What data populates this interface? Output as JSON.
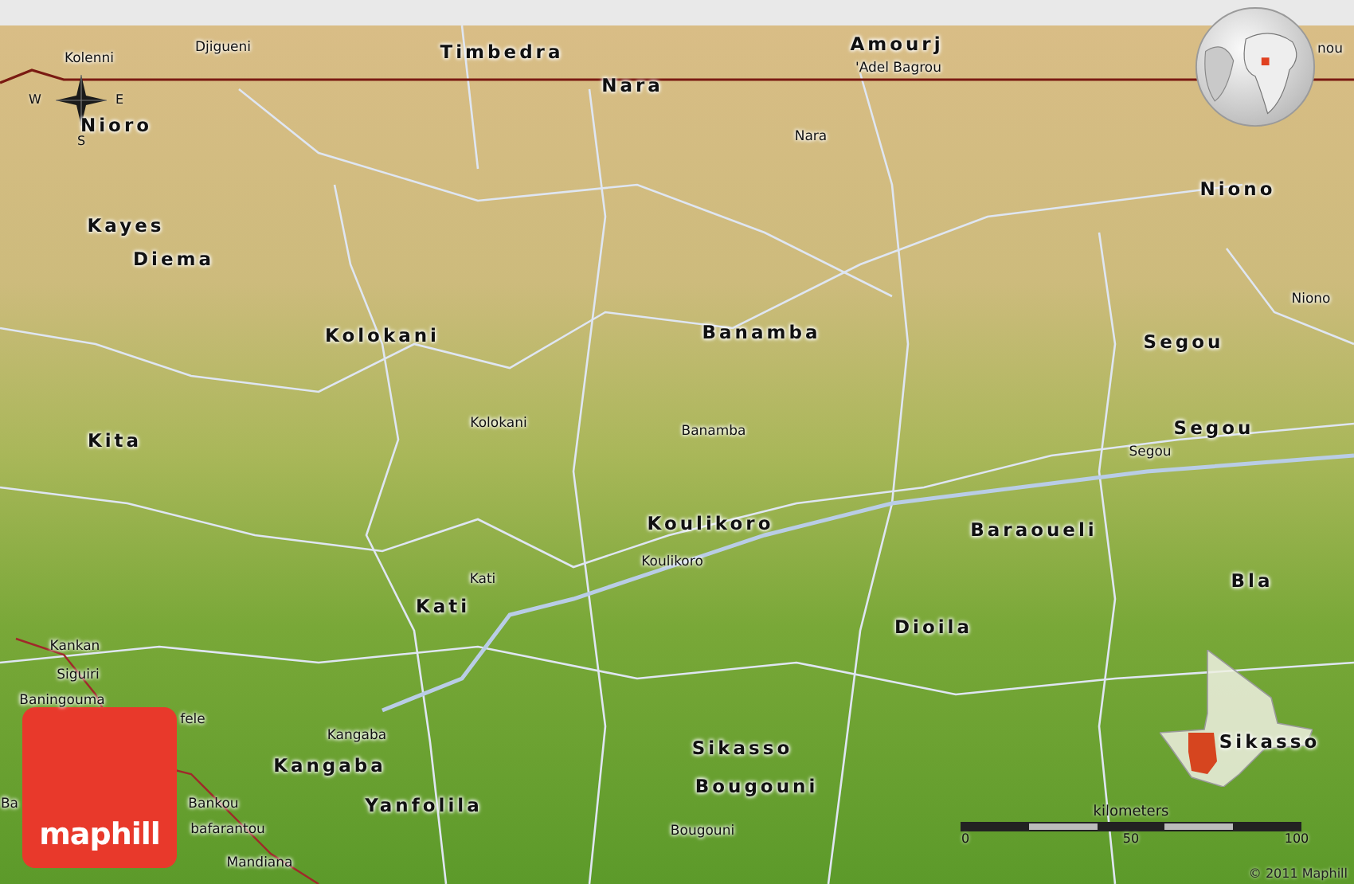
{
  "map": {
    "labels": [
      {
        "text": "Djigueni",
        "kind": "town"
      },
      {
        "text": "Timbedra",
        "kind": "region"
      },
      {
        "text": "Amourj",
        "kind": "region"
      },
      {
        "text": "'Adel Bagrou",
        "kind": "town"
      },
      {
        "text": "Nara",
        "kind": "region"
      },
      {
        "text": "nou",
        "kind": "town"
      },
      {
        "text": "Kolenni",
        "kind": "town"
      },
      {
        "text": "Nioro",
        "kind": "region"
      },
      {
        "text": "Nara",
        "kind": "town"
      },
      {
        "text": "Niono",
        "kind": "region"
      },
      {
        "text": "Kayes",
        "kind": "region"
      },
      {
        "text": "Diema",
        "kind": "region"
      },
      {
        "text": "Niono",
        "kind": "town"
      },
      {
        "text": "Kolokani",
        "kind": "region"
      },
      {
        "text": "Banamba",
        "kind": "region"
      },
      {
        "text": "Segou",
        "kind": "region"
      },
      {
        "text": "Kolokani",
        "kind": "town"
      },
      {
        "text": "Banamba",
        "kind": "town"
      },
      {
        "text": "Kita",
        "kind": "region"
      },
      {
        "text": "Segou",
        "kind": "region"
      },
      {
        "text": "Segou",
        "kind": "town"
      },
      {
        "text": "Koulikoro",
        "kind": "region"
      },
      {
        "text": "Baraoueli",
        "kind": "region"
      },
      {
        "text": "Koulikoro",
        "kind": "town"
      },
      {
        "text": "Kati",
        "kind": "town"
      },
      {
        "text": "Bla",
        "kind": "region"
      },
      {
        "text": "Kati",
        "kind": "region"
      },
      {
        "text": "Dioila",
        "kind": "region"
      },
      {
        "text": "Kankan",
        "kind": "town"
      },
      {
        "text": "Siguiri",
        "kind": "town"
      },
      {
        "text": "Baningouma",
        "kind": "town"
      },
      {
        "text": "fele",
        "kind": "town"
      },
      {
        "text": "Kangaba",
        "kind": "town"
      },
      {
        "text": "Sikasso",
        "kind": "region"
      },
      {
        "text": "Sikasso",
        "kind": "region"
      },
      {
        "text": "Kangaba",
        "kind": "region"
      },
      {
        "text": "Bougouni",
        "kind": "region"
      },
      {
        "text": "Ba",
        "kind": "town"
      },
      {
        "text": "Bankou",
        "kind": "town"
      },
      {
        "text": "Yanfolila",
        "kind": "region"
      },
      {
        "text": "bafarantou",
        "kind": "town"
      },
      {
        "text": "Bougouni",
        "kind": "town"
      },
      {
        "text": "Mandiana",
        "kind": "town"
      }
    ]
  },
  "compass": {
    "directions": [
      "W",
      "E",
      "S"
    ]
  },
  "scale_bar": {
    "unit": "kilometers",
    "ticks": [
      "0",
      "50",
      "100"
    ]
  },
  "logo": {
    "text": "maphill"
  },
  "copyright": "© 2011 Maphill"
}
